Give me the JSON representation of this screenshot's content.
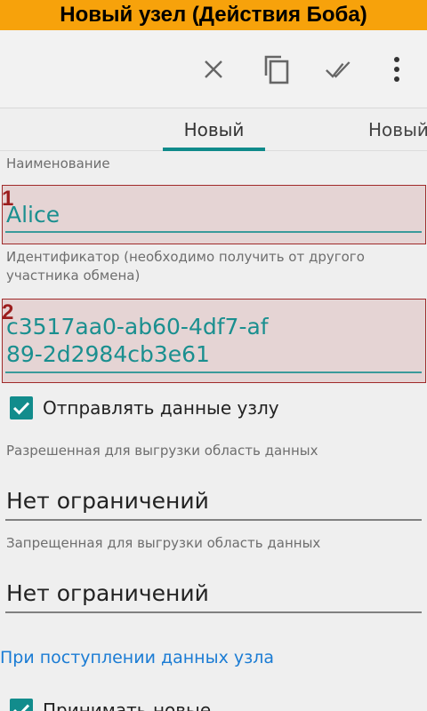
{
  "window_title": "Новый узел (Действия Боба)",
  "toolbar": {
    "icons": [
      "close-icon",
      "copy-icon",
      "done-all-icon",
      "more-vert-icon"
    ]
  },
  "tabs": {
    "active": "Новый",
    "next": "Новый"
  },
  "name_field": {
    "label": "Наименование",
    "marker": "1",
    "value": "Alice"
  },
  "id_field": {
    "label": "Идентификатор (необходимо получить от другого участника обмена)",
    "marker": "2",
    "value": "c3517aa0-ab60-4df7-af89-2d2984cb3e61"
  },
  "send_data": {
    "label": "Отправлять данные узлу",
    "checked": true
  },
  "allowed_area": {
    "label": "Разрешенная для выгрузки область данных",
    "value": "Нет ограничений"
  },
  "forbidden_area": {
    "label": "Запрещенная для выгрузки область данных",
    "value": "Нет ограничений"
  },
  "on_receive": {
    "section": "При поступлении данных узла",
    "accept_label": "Принимать новые",
    "checked": true
  },
  "colors": {
    "accent": "#128c8c",
    "title_bar": "#f7a20b",
    "link": "#1b7cd4",
    "highlight_border": "#a02a2a"
  }
}
